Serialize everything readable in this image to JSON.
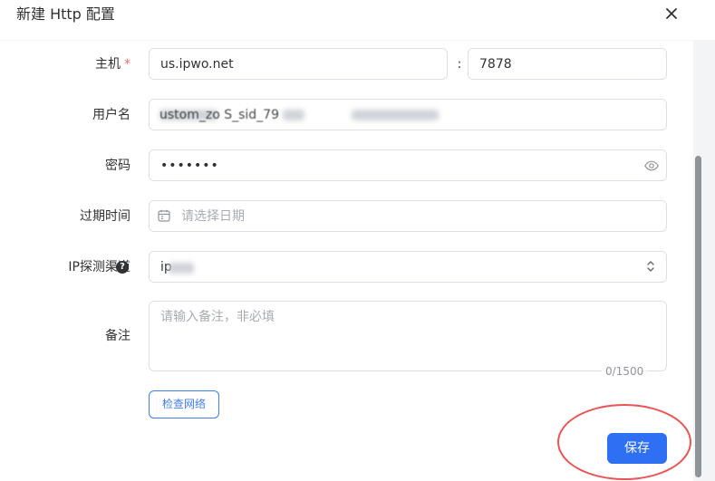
{
  "dialog": {
    "title": "新建 Http 配置",
    "close_icon": "close-icon"
  },
  "labels": {
    "host": "主机",
    "host_required": "*",
    "username": "用户名",
    "password": "密码",
    "expire_time": "过期时间",
    "ip_detect_channel": "IP探测渠道",
    "note": "备注"
  },
  "fields": {
    "host_value": "us.ipwo.net",
    "port_separator": ":",
    "port_value": "7878",
    "username_visible_fragment": "ustom_zo S_sid_79",
    "password_mask": "•••••••",
    "date_placeholder": "请选择日期",
    "ip_detect_value_visible": "ip",
    "note_placeholder": "请输入备注，非必填",
    "note_counter": "0/1500"
  },
  "icons": {
    "eye": "eye-icon",
    "calendar": "calendar-icon",
    "select_caret": "chevron-up-down-icon",
    "help": "question-circle-icon",
    "help_glyph": "?"
  },
  "buttons": {
    "check_network": "检查网络",
    "save": "保存"
  },
  "colors": {
    "primary": "#2f6ff2",
    "annotation": "#ea5454"
  }
}
